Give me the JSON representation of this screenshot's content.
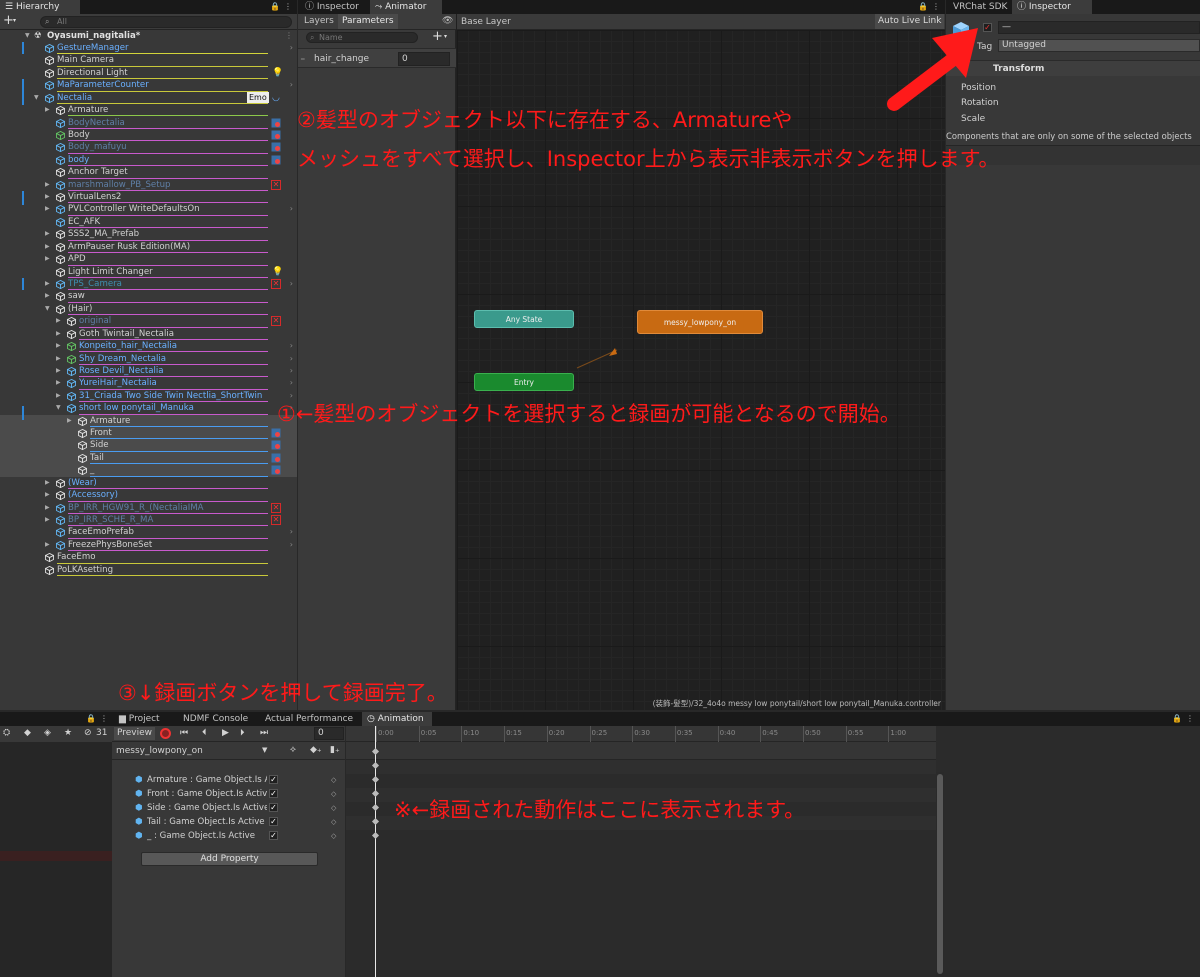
{
  "hierarchy": {
    "tab": "Hierarchy",
    "search_placeholder": "All",
    "scene": "Oyasumi_nagitalia*",
    "items": [
      {
        "label": "GestureManager",
        "indent": 0,
        "color": "#6ab0ff",
        "line": "#d2d43a",
        "cube": "#61b4f0",
        "arrow": "right"
      },
      {
        "label": "Main Camera",
        "indent": 0,
        "color": "#d2d2d2",
        "line": "#c8c83a",
        "cube": "#ddd"
      },
      {
        "label": "Directional Light",
        "indent": 0,
        "color": "#d2d2d2",
        "line": "#c8c83a",
        "cube": "#ddd",
        "badge": "bulb"
      },
      {
        "label": "MaParameterCounter",
        "indent": 0,
        "color": "#6ab0ff",
        "line": "#c8c83a",
        "cube": "#61b4f0",
        "arrow": "right"
      },
      {
        "label": "Nectalia",
        "indent": 0,
        "color": "#6ab0ff",
        "line": "#c8c83a",
        "cube": "#61b4f0",
        "expanded": true,
        "extra": "Emo"
      },
      {
        "label": "Armature",
        "indent": 1,
        "color": "#d2d2d2",
        "line": "#8cc84a",
        "cube": "#ddd",
        "collapsed": true
      },
      {
        "label": "BodyNectalia",
        "indent": 1,
        "color": "#5f7fa6",
        "line": "#c85acc",
        "cube": "#61b4f0",
        "badge": "rec"
      },
      {
        "label": "Body",
        "indent": 1,
        "color": "#d2d2d2",
        "line": "#c85acc",
        "cube": "#62c162",
        "badge": "rec"
      },
      {
        "label": "Body_mafuyu",
        "indent": 1,
        "color": "#5f7fa6",
        "line": "#c85acc",
        "cube": "#61b4f0",
        "badge": "rec"
      },
      {
        "label": "body",
        "indent": 1,
        "color": "#6ab0ff",
        "line": "#c85acc",
        "cube": "#61b4f0",
        "badge": "rec"
      },
      {
        "label": "Anchor Target",
        "indent": 1,
        "color": "#d2d2d2",
        "line": "#c85acc",
        "cube": "#ddd"
      },
      {
        "label": "marshmallow_PB_Setup",
        "indent": 1,
        "color": "#5f7fa6",
        "line": "#c85acc",
        "cube": "#61b4f0",
        "collapsed": true,
        "badge": "x"
      },
      {
        "label": "VirtualLens2",
        "indent": 1,
        "color": "#d2d2d2",
        "line": "#c85acc",
        "cube": "#ddd",
        "collapsed": true
      },
      {
        "label": "PVLController WriteDefaultsOn",
        "indent": 1,
        "color": "#d2d2d2",
        "line": "#c85acc",
        "cube": "#61b4f0",
        "collapsed": true,
        "arrow": "right"
      },
      {
        "label": "EC_AFK",
        "indent": 1,
        "color": "#d2d2d2",
        "line": "#c85acc",
        "cube": "#61b4f0"
      },
      {
        "label": "SSS2_MA_Prefab",
        "indent": 1,
        "color": "#d2d2d2",
        "line": "#c85acc",
        "cube": "#ddd",
        "collapsed": true
      },
      {
        "label": "ArmPauser Rusk Edition(MA)",
        "indent": 1,
        "color": "#d2d2d2",
        "line": "#c85acc",
        "cube": "#ddd",
        "collapsed": true
      },
      {
        "label": "APD",
        "indent": 1,
        "color": "#d2d2d2",
        "line": "#c85acc",
        "cube": "#ddd",
        "collapsed": true
      },
      {
        "label": "Light Limit Changer",
        "indent": 1,
        "color": "#d2d2d2",
        "line": "#c85acc",
        "cube": "#ddd",
        "badge": "bulb"
      },
      {
        "label": "TPS_Camera",
        "indent": 1,
        "color": "#3e8fb0",
        "line": "#c85acc",
        "cube": "#61b4f0",
        "collapsed": true,
        "badge": "x",
        "arrow": "right"
      },
      {
        "label": "saw",
        "indent": 1,
        "color": "#d2d2d2",
        "line": "#c85acc",
        "cube": "#ddd",
        "collapsed": true
      },
      {
        "label": "(Hair)",
        "indent": 1,
        "color": "#d2d2d2",
        "line": "#c85acc",
        "cube": "#ddd",
        "expanded": true
      },
      {
        "label": "original",
        "indent": 2,
        "color": "#5f7fa6",
        "line": "#c85acc",
        "cube": "#ddd",
        "collapsed": true,
        "badge": "x"
      },
      {
        "label": "Goth Twintail_Nectalia",
        "indent": 2,
        "color": "#d2d2d2",
        "line": "#c85acc",
        "cube": "#ddd",
        "collapsed": true
      },
      {
        "label": "Konpeito_hair_Nectalia",
        "indent": 2,
        "color": "#6ab0ff",
        "line": "#c85acc",
        "cube": "#62c162",
        "collapsed": true,
        "arrow": "right"
      },
      {
        "label": "Shy Dream_Nectalia",
        "indent": 2,
        "color": "#6ab0ff",
        "line": "#c85acc",
        "cube": "#62c162",
        "collapsed": true,
        "arrow": "right"
      },
      {
        "label": "Rose Devil_Nectalia",
        "indent": 2,
        "color": "#6ab0ff",
        "line": "#c85acc",
        "cube": "#61b4f0",
        "collapsed": true,
        "arrow": "right"
      },
      {
        "label": "YureiHair_Nectalia",
        "indent": 2,
        "color": "#6ab0ff",
        "line": "#c85acc",
        "cube": "#61b4f0",
        "collapsed": true,
        "arrow": "right"
      },
      {
        "label": "31_Criada Two Side Twin Nectlia_ShortTwin",
        "indent": 2,
        "color": "#6ab0ff",
        "line": "#c85acc",
        "cube": "#61b4f0",
        "collapsed": true,
        "arrow": "right"
      },
      {
        "label": "short low ponytail_Manuka",
        "indent": 2,
        "color": "#6ab0ff",
        "line": "#c85acc",
        "cube": "#61b4f0",
        "expanded": true,
        "arrow": "right"
      },
      {
        "label": "Armature",
        "indent": 3,
        "color": "#d2d2d2",
        "line": "#4a9cf0",
        "cube": "#ddd",
        "collapsed": true,
        "sel": true
      },
      {
        "label": "Front",
        "indent": 3,
        "color": "#d2d2d2",
        "line": "#4a9cf0",
        "cube": "#ddd",
        "sel": true,
        "badge": "rec"
      },
      {
        "label": "Side",
        "indent": 3,
        "color": "#d2d2d2",
        "line": "#4a9cf0",
        "cube": "#ddd",
        "sel": true,
        "badge": "rec"
      },
      {
        "label": "Tail",
        "indent": 3,
        "color": "#d2d2d2",
        "line": "#4a9cf0",
        "cube": "#ddd",
        "sel": true,
        "badge": "rec"
      },
      {
        "label": "_",
        "indent": 3,
        "color": "#d2d2d2",
        "line": "#4a9cf0",
        "cube": "#ddd",
        "sel": true,
        "badge": "rec"
      },
      {
        "label": "(Wear)",
        "indent": 1,
        "color": "#6ab0ff",
        "line": "#c85acc",
        "cube": "#ddd",
        "collapsed": true
      },
      {
        "label": "(Accessory)",
        "indent": 1,
        "color": "#6ab0ff",
        "line": "#c85acc",
        "cube": "#ddd",
        "collapsed": true
      },
      {
        "label": "BP_IRR_HGW91_R_(NectaliaIMA",
        "indent": 1,
        "color": "#5f7fa6",
        "line": "#c85acc",
        "cube": "#61b4f0",
        "collapsed": true,
        "badge": "x"
      },
      {
        "label": "BP_IRR_SCHE_R_MA",
        "indent": 1,
        "color": "#5f7fa6",
        "line": "#c85acc",
        "cube": "#61b4f0",
        "collapsed": true,
        "badge": "x"
      },
      {
        "label": "FaceEmoPrefab",
        "indent": 1,
        "color": "#d2d2d2",
        "line": "#c85acc",
        "cube": "#61b4f0",
        "arrow": "right"
      },
      {
        "label": "FreezePhysBoneSet",
        "indent": 1,
        "color": "#d2d2d2",
        "line": "#c85acc",
        "cube": "#61b4f0",
        "collapsed": true,
        "arrow": "right"
      },
      {
        "label": "FaceEmo",
        "indent": 0,
        "color": "#d2d2d2",
        "line": "#c8c83a",
        "cube": "#ddd"
      },
      {
        "label": "PoLKAsetting",
        "indent": 0,
        "color": "#d2d2d2",
        "line": "#c8c83a",
        "cube": "#ddd"
      }
    ]
  },
  "animator": {
    "tabs": [
      "Inspector",
      "Animator"
    ],
    "subtabs": [
      "Layers",
      "Parameters"
    ],
    "search_placeholder": "Name",
    "param_name": "hair_change",
    "param_value": "0",
    "layer_name": "Base Layer",
    "auto_live_link": "Auto Live Link",
    "states": {
      "any": "Any State",
      "default": "messy_lowpony_on",
      "entry": "Entry"
    },
    "footer_path": "(装飾-髪型)/32_4o4o messy low ponytail/short low ponytail_Manuka.controller"
  },
  "inspector": {
    "tabs": [
      "VRChat SDK",
      "Inspector"
    ],
    "name_field": "—",
    "tag_label": "Tag",
    "tag_value": "Untagged",
    "transform_title": "Transform",
    "fields": [
      "Position",
      "Rotation",
      "Scale"
    ],
    "note": "Components that are only on some of the selected objects"
  },
  "animation": {
    "tabs": [
      "Project",
      "NDMF Console",
      "Actual Performance",
      "Animation"
    ],
    "preview": "Preview",
    "frame": "0",
    "layer_count": "31",
    "clip": "messy_lowpony_on",
    "properties": [
      "Armature : Game Object.Is A",
      "Front : Game Object.Is Activ",
      "Side : Game Object.Is Active",
      "Tail : Game Object.Is Active",
      "_ : Game Object.Is Active"
    ],
    "add_property": "Add Property",
    "ticks": [
      "0:00",
      "0:05",
      "0:10",
      "0:15",
      "0:20",
      "0:25",
      "0:30",
      "0:35",
      "0:40",
      "0:45",
      "0:50",
      "0:55",
      "1:00"
    ]
  },
  "annotations": {
    "step2_line1": "②髪型のオブジェクト以下に存在する、Armatureや",
    "step2_line2": "メッシュをすべて選択し、Inspector上から表示非表示ボタンを押します。",
    "step1": "①←髪型のオブジェクトを選択すると録画が可能となるので開始。",
    "step3": "③↓録画ボタンを押して録画完了。",
    "note": "※←録画された動作はここに表示されます。"
  },
  "colors": {
    "annotation": "#ff1a1a",
    "accent": "#2d86d8",
    "default_state": "#c86a12",
    "any_state": "#3a9a8c",
    "entry_state": "#1a8a2e"
  }
}
